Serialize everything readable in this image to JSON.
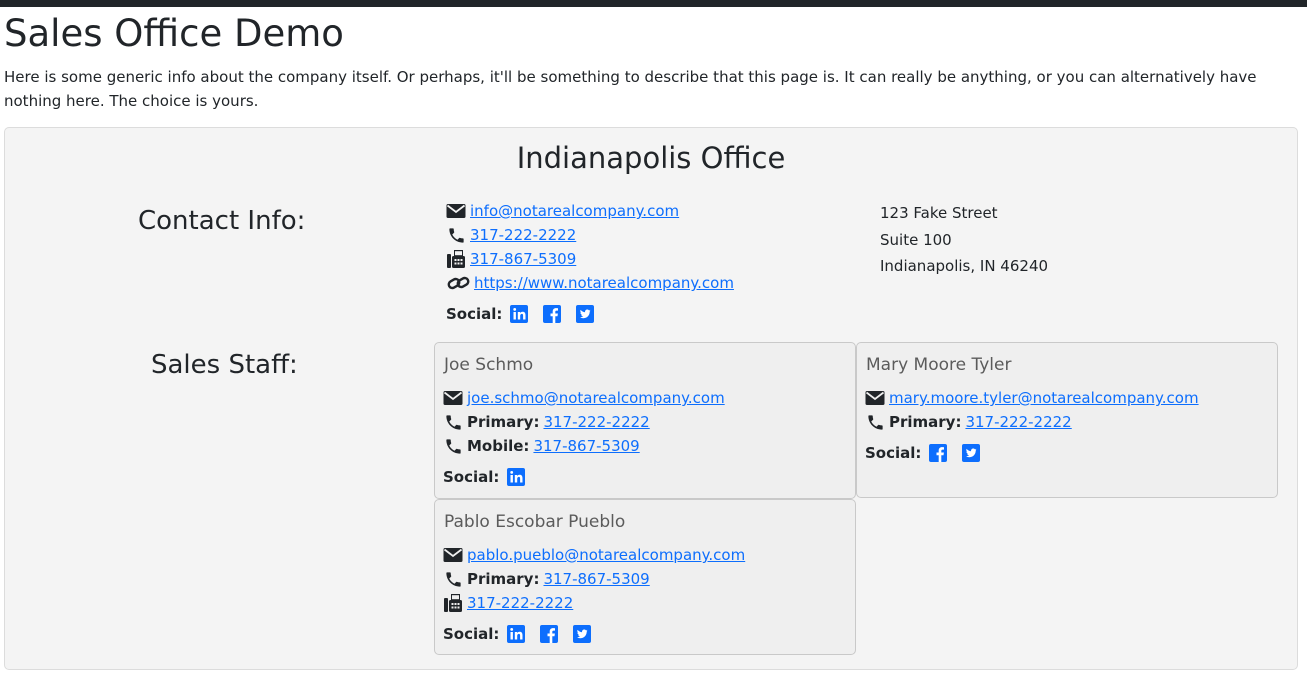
{
  "page": {
    "title": "Sales Office Demo",
    "intro": "Here is some generic info about the company itself. Or perhaps, it'll be something to describe that this page is. It can really be anything, or you can alternatively have nothing here. The choice is yours."
  },
  "office": {
    "name": "Indianapolis Office",
    "contact_label": "Contact Info:",
    "email": "info@notarealcompany.com",
    "phone": "317-222-2222",
    "fax": "317-867-5309",
    "website": "https://www.notarealcompany.com",
    "social_label": "Social:",
    "address": {
      "line1": "123 Fake Street",
      "line2": "Suite 100",
      "line3": "Indianapolis, IN 46240"
    }
  },
  "staff_label": "Sales Staff:",
  "staff": [
    {
      "name": "Joe Schmo",
      "email": "joe.schmo@notarealcompany.com",
      "primary_label": "Primary:",
      "primary": "317-222-2222",
      "mobile_label": "Mobile:",
      "mobile": "317-867-5309",
      "social_label": "Social:"
    },
    {
      "name": "Mary Moore Tyler",
      "email": "mary.moore.tyler@notarealcompany.com",
      "primary_label": "Primary:",
      "primary": "317-222-2222",
      "social_label": "Social:"
    },
    {
      "name": "Pablo Escobar Pueblo",
      "email": "pablo.pueblo@notarealcompany.com",
      "primary_label": "Primary:",
      "primary": "317-867-5309",
      "fax": "317-222-2222",
      "social_label": "Social:"
    }
  ],
  "icons": {
    "email": "envelope-icon",
    "phone": "phone-icon",
    "fax": "fax-icon",
    "web": "link-icon",
    "linkedin": "linkedin-icon",
    "facebook": "facebook-icon",
    "twitter": "twitter-icon"
  },
  "colors": {
    "link": "#0d6efd",
    "text": "#212529",
    "topbar": "#212529",
    "card": "#f4f4f4",
    "staff_card": "#efefef"
  }
}
